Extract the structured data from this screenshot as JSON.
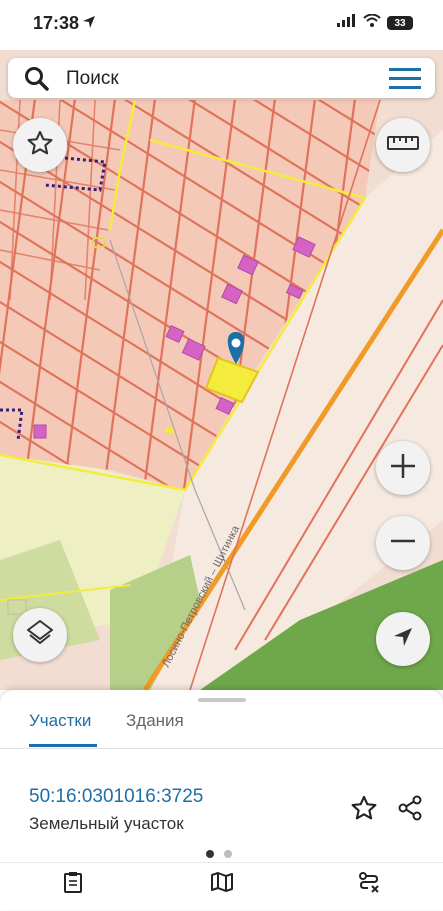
{
  "status": {
    "time": "17:38",
    "battery": "33"
  },
  "search": {
    "placeholder": "Поиск"
  },
  "map": {
    "road_name": "Лосино-Петровский – Щитинка",
    "colors": {
      "accent": "#1d6fa8",
      "parcel_line": "#e0735c",
      "highlight": "#f4ec3c",
      "building": "#d463c4",
      "road": "#f09a28"
    }
  },
  "sheet": {
    "tabs": [
      {
        "label": "Участки",
        "active": true
      },
      {
        "label": "Здания",
        "active": false
      }
    ],
    "parcel": {
      "cadastral_number": "50:16:0301016:3725",
      "type": "Земельный участок"
    },
    "page_dots": {
      "count": 2,
      "active": 0
    }
  },
  "icons": {
    "favorite": "star-icon",
    "ruler": "ruler-icon",
    "layers": "layers-icon",
    "zoom_in": "plus-icon",
    "zoom_out": "minus-icon",
    "locate": "navigation-arrow-icon",
    "share": "share-icon",
    "menu": "hamburger-menu-icon"
  }
}
